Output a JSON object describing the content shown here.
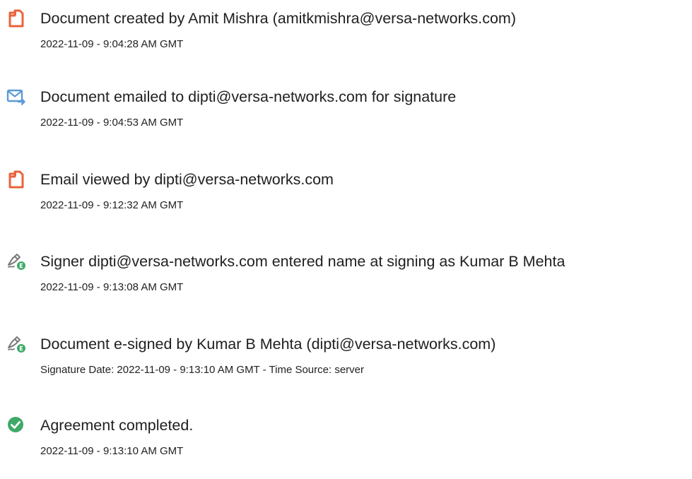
{
  "events": [
    {
      "icon": "document-created-icon",
      "title": "Document created by Amit Mishra (amitkmishra@versa-networks.com)",
      "meta": "2022-11-09 - 9:04:28 AM GMT"
    },
    {
      "icon": "email-sent-icon",
      "title": "Document emailed to dipti@versa-networks.com for signature",
      "meta": "2022-11-09 - 9:04:53 AM GMT"
    },
    {
      "icon": "document-viewed-icon",
      "title": "Email viewed by dipti@versa-networks.com",
      "meta": "2022-11-09 - 9:12:32 AM GMT"
    },
    {
      "icon": "e-sign-pen-icon",
      "title": "Signer dipti@versa-networks.com entered name at signing as Kumar B Mehta",
      "meta": "2022-11-09 - 9:13:08 AM GMT"
    },
    {
      "icon": "e-sign-pen-icon",
      "title": "Document e-signed by Kumar B Mehta (dipti@versa-networks.com)",
      "meta": "Signature Date: 2022-11-09 - 9:13:10 AM GMT - Time Source: server"
    },
    {
      "icon": "check-circle-icon",
      "title": "Agreement completed.",
      "meta": "2022-11-09 - 9:13:10 AM GMT"
    }
  ],
  "colors": {
    "document_icon": "#e8643c",
    "email_icon": "#5b9bd5",
    "sign_icon": "#7a7a7a",
    "sign_badge": "#3fa968",
    "check": "#3fa968"
  }
}
